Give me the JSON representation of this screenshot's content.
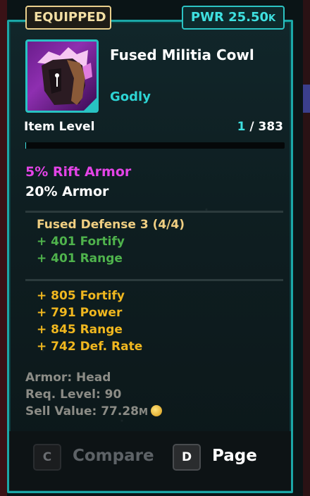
{
  "badges": {
    "equipped": "EQUIPPED",
    "power_prefix": "PWR 25.50",
    "power_suffix": "K"
  },
  "item": {
    "name": "Fused Militia Cowl",
    "rarity": "Godly"
  },
  "level": {
    "label": "Item Level",
    "current": "1",
    "max": "/ 383",
    "progress": 0.0026
  },
  "stats": {
    "rift_armor": "5% Rift Armor",
    "armor": "20% Armor"
  },
  "set": {
    "title": "Fused Defense 3 (4/4)",
    "bonuses": [
      "+ 401 Fortify",
      "+ 401 Range"
    ]
  },
  "bonuses": [
    "+ 805 Fortify",
    "+ 791 Power",
    "+ 845 Range",
    "+ 742 Def. Rate"
  ],
  "meta": {
    "armor_slot": "Armor: Head",
    "req_level": "Req. Level: 90",
    "sell_value": "Sell Value: 77.28",
    "sell_suffix": "M"
  },
  "actions": {
    "compare_key": "C",
    "compare_label": "Compare",
    "page_key": "D",
    "page_label": "Page"
  },
  "colors": {
    "accent": "#2cc3c3",
    "rift": "#e344e6",
    "set": "#4fb34c",
    "bonus": "#f0b71f"
  },
  "icons": {
    "item": "dark-helmet-icon",
    "currency": "gold-coin-icon"
  }
}
